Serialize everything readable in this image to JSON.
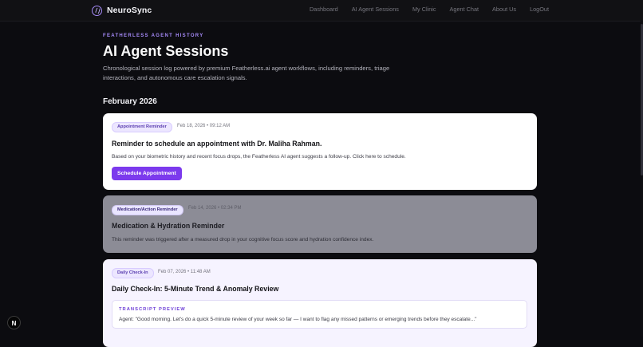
{
  "brand": {
    "name": "NeuroSync"
  },
  "nav": {
    "items": [
      "Dashboard",
      "AI Agent Sessions",
      "My Clinic",
      "Agent Chat",
      "About Us",
      "LogOut"
    ]
  },
  "hero": {
    "eyebrow": "FEATHERLESS AGENT HISTORY",
    "title": "AI Agent Sessions",
    "description": "Chronological session log powered by premium Featherless.ai agent workflows, including reminders, triage interactions, and autonomous care escalation signals."
  },
  "month": "February 2026",
  "sessions": [
    {
      "badge": "Appointment Reminder",
      "date": "Feb 18, 2026 • 09:12 AM",
      "title": "Reminder to schedule an appointment with Dr. Maliha Rahman.",
      "body": "Based on your biometric history and recent focus drops, the Featherless AI agent suggests a follow-up. Click here to schedule.",
      "cta": "Schedule Appointment"
    },
    {
      "badge": "Medication/Action Reminder",
      "date": "Feb 14, 2026 • 02:34 PM",
      "title": "Medication & Hydration Reminder",
      "body": "This reminder was triggered after a measured drop in your cognitive focus score and hydration confidence index."
    },
    {
      "badge": "Daily Check-In",
      "date": "Feb 07, 2026 • 11:48 AM",
      "title": "Daily Check-In: 5-Minute Trend & Anomaly Review",
      "transcript_label": "TRANSCRIPT PREVIEW",
      "transcript_text": "Agent: \"Good morning. Let's do a quick 5-minute review of your week so far — I want to flag any missed patterns or emerging trends before they escalate...\""
    }
  ],
  "dev_indicator": "N",
  "colors": {
    "accent": "#7c3aed",
    "background": "#0c0c10",
    "eyebrow": "#a78bfa"
  }
}
